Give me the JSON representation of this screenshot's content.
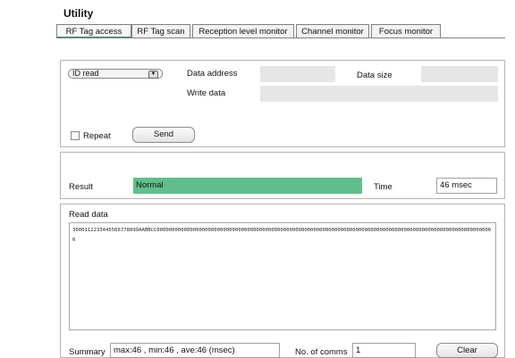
{
  "app": {
    "title": "Utility"
  },
  "tabs": [
    {
      "label": "RF Tag access"
    },
    {
      "label": "RF Tag scan"
    },
    {
      "label": "Reception level monitor"
    },
    {
      "label": "Channel monitor"
    },
    {
      "label": "Focus monitor"
    }
  ],
  "command": {
    "select_value": "ID read",
    "data_address_label": "Data address",
    "data_size_label": "Data size",
    "write_data_label": "Write data",
    "repeat_label": "Repeat",
    "send_label": "Send"
  },
  "result": {
    "label": "Result",
    "value": "Normal",
    "time_label": "Time",
    "time_value": "46 msec"
  },
  "read": {
    "label": "Read data",
    "value": "300011223344556677889​9AABBCC0000000000000000000000000000000000000000000000000000000000000000000000000000000000000000000000000000000000000000"
  },
  "summary": {
    "label": "Summary",
    "value": "max:46 , min:46 , ave:46  (msec)",
    "comms_label": "No. of comms",
    "comms_value": "1",
    "clear_label": "Clear"
  },
  "colors": {
    "accent": "#3a8c7a",
    "result_ok": "#5fbf8b"
  },
  "icons": {
    "dropdown": "chevron-down-icon"
  }
}
